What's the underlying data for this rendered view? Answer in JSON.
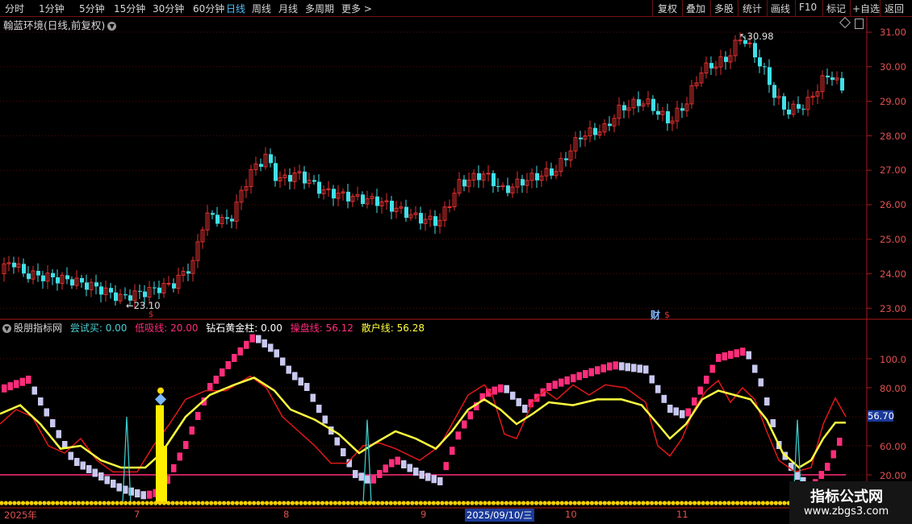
{
  "toolbar": {
    "periods": [
      "分时",
      "1分钟",
      "5分钟",
      "15分钟",
      "30分钟",
      "60分钟",
      "日线",
      "周线",
      "月线",
      "多周期",
      "更多 >"
    ],
    "active": "日线",
    "right_buttons": [
      "复权",
      "叠加",
      "多股",
      "统计",
      "画线",
      "F10",
      "标记",
      "+自选",
      "返回"
    ]
  },
  "main": {
    "title": "翰蓝环境(日线,前复权)",
    "high_label": "30.98",
    "low_label": "23.10",
    "cai_label": "财",
    "s_marker": "$",
    "y_ticks": [
      "31.00",
      "30.00",
      "29.00",
      "28.00",
      "27.00",
      "26.00",
      "25.00",
      "24.00",
      "23.00"
    ]
  },
  "indicator": {
    "name": "股朋指标网",
    "items": [
      {
        "label": "尝试买: 0.00",
        "color": "#4dd0d0"
      },
      {
        "label": "低吸线: 20.00",
        "color": "#ff2d7a"
      },
      {
        "label": "钻石黄金柱: 0.00",
        "color": "#ffffff"
      },
      {
        "label": "操盘线: 56.12",
        "color": "#ff2d7a"
      },
      {
        "label": "散户线: 56.28",
        "color": "#ffff40"
      }
    ],
    "y_ticks": [
      "100.0",
      "80.00",
      "60.00",
      "40.00",
      "20.00"
    ],
    "current_value": "56.70"
  },
  "dates": {
    "labels": [
      "2025年",
      "7",
      "8",
      "9",
      "10",
      "11"
    ],
    "highlight": "2025/09/10/三"
  },
  "watermark": {
    "title": "指标公式网",
    "url": "www.zbgs3.com"
  },
  "colors": {
    "up": "#e03030",
    "down": "#40e0e8",
    "accent": "#4fc3ff",
    "grid": "#5a0a0a"
  }
}
